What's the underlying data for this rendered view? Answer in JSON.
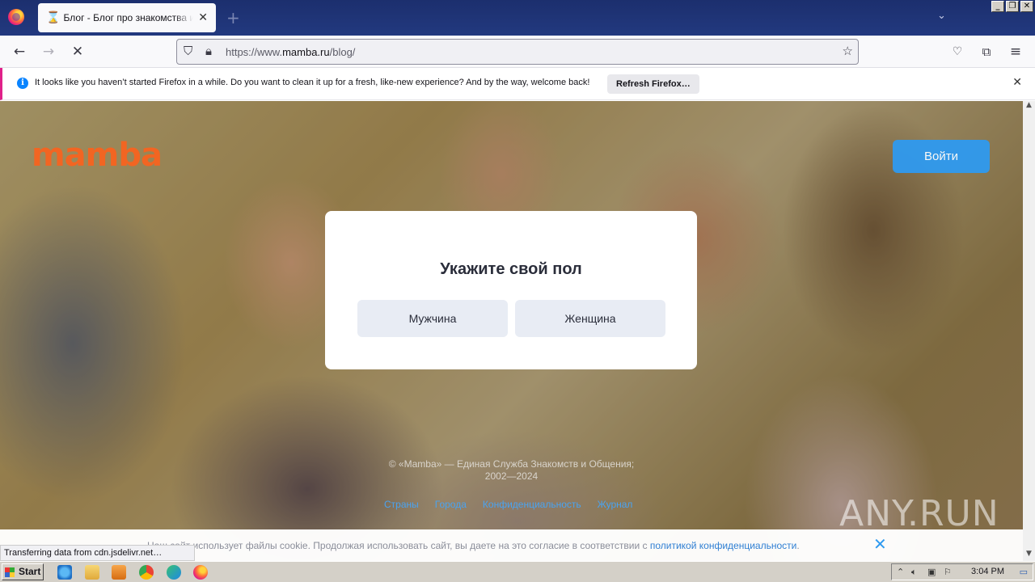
{
  "browser": {
    "tab": {
      "title": "Блог - Блог про знакомства и отношения"
    },
    "url_prefix": "https://www.",
    "url_domain": "mamba.ru",
    "url_path": "/blog/",
    "notification": {
      "message": "It looks like you haven’t started Firefox in a while. Do you want to clean it up for a fresh, like-new experience? And by the way, welcome back!",
      "button": "Refresh Firefox…"
    },
    "status": "Transferring data from cdn.jsdelivr.net…"
  },
  "page": {
    "logo": "mamba",
    "login_button": "Войти",
    "modal": {
      "title": "Укажите свой пол",
      "options": [
        "Мужчина",
        "Женщина"
      ]
    },
    "footer": {
      "copyright_line1": "© «Mamba» — Единая Служба Знакомств и Общения;",
      "copyright_line2": "2002—2024",
      "links": [
        "Страны",
        "Города",
        "Конфиденциальность",
        "Журнал"
      ]
    },
    "cookie": {
      "text": "Наш сайт использует файлы cookie. Продолжая использовать сайт, вы даете на это согласие в соответствии с ",
      "link": "политикой конфиденциальности",
      "suffix": "."
    },
    "watermark": "ANY.RUN"
  },
  "taskbar": {
    "start": "Start",
    "time": "3:04 PM"
  },
  "colors": {
    "brand": "#f26522",
    "accent": "#2f9af0",
    "notification_border": "#e0218a"
  }
}
